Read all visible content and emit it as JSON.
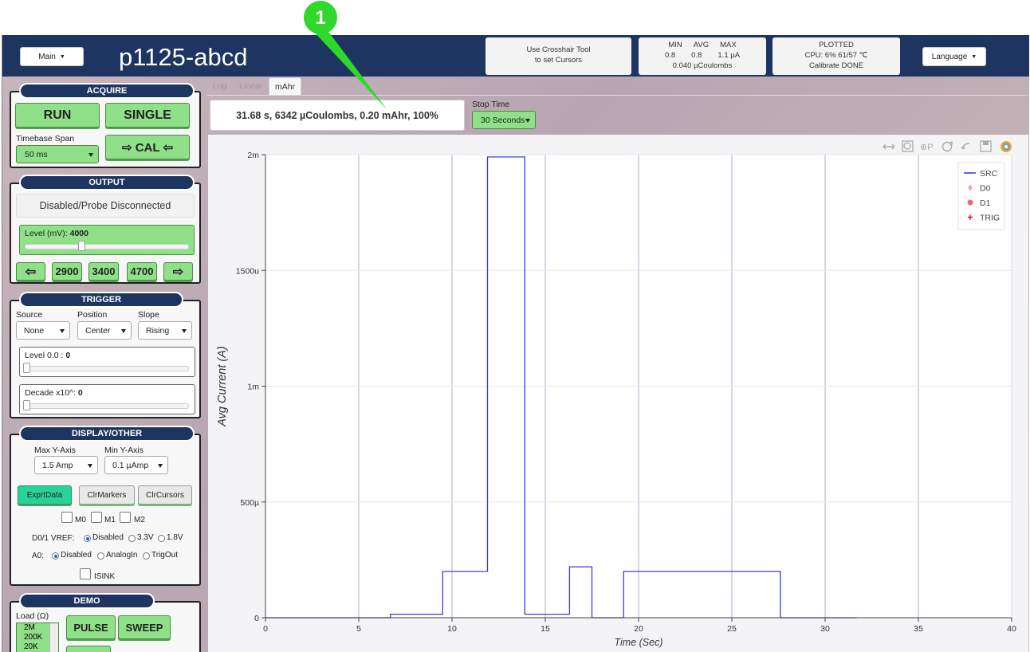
{
  "callout": {
    "number": "1"
  },
  "header": {
    "main_menu": "Main",
    "title": "p1125-abcd",
    "cursor_hint_line1": "Use Crosshair Tool",
    "cursor_hint_line2": "to set Cursors",
    "stats_labels": {
      "min": "MIN",
      "avg": "AVG",
      "max": "MAX"
    },
    "stats_values": {
      "min": "0.8",
      "avg": "0.8",
      "max": "1.1 µA"
    },
    "stats_charge": "0.040 µCoulombs",
    "status_line1": "PLOTTED",
    "status_line2": "CPU:  6% 61/57 ℃",
    "status_line3": "Calibrate DONE",
    "language": "Language"
  },
  "acquire": {
    "title": "ACQUIRE",
    "run": "RUN",
    "single": "SINGLE",
    "timebase_label": "Timebase Span",
    "timebase_value": "50 ms",
    "cal": "⇨ CAL ⇦"
  },
  "output": {
    "title": "OUTPUT",
    "status": "Disabled/Probe Disconnected",
    "level_label": "Level (mV): ",
    "level_value": "4000",
    "level_fraction": 0.35,
    "left_arrow": "⇦",
    "presets": [
      "2900",
      "3400",
      "4700"
    ],
    "right_arrow": "⇨"
  },
  "trigger": {
    "title": "TRIGGER",
    "source_label": "Source",
    "source_value": "None",
    "position_label": "Position",
    "position_value": "Center",
    "slope_label": "Slope",
    "slope_value": "Rising",
    "level_label": "Level 0.0 : ",
    "level_value": "0",
    "decade_label": "Decade x10^: ",
    "decade_value": "0"
  },
  "display": {
    "title": "DISPLAY/OTHER",
    "max_y_label": "Max Y-Axis",
    "max_y_value": "1.5 Amp",
    "min_y_label": "Min Y-Axis",
    "min_y_value": "0.1 µAmp",
    "export": "ExprtData",
    "clr_markers": "ClrMarkers",
    "clr_cursors": "ClrCursors",
    "markers": [
      "M0",
      "M1",
      "M2"
    ],
    "vref_label": "D0/1 VREF:",
    "vref_options": [
      "Disabled",
      "3.3V",
      "1.8V"
    ],
    "a0_label": "A0:",
    "a0_options": [
      "Disabled",
      "AnalogIn",
      "TrigOut"
    ],
    "isink": "ISINK"
  },
  "demo": {
    "title": "DEMO",
    "load_label": "Load (Ω)",
    "loads": [
      "2M",
      "200K",
      "20K"
    ],
    "pulse": "PULSE",
    "sweep": "SWEEP"
  },
  "tabs": [
    "Log",
    "Linear",
    "mAhr"
  ],
  "active_tab": "mAhr",
  "summary": "31.68 s, 6342 µCoulombs, 0.20 mAhr, 100%",
  "stop_time": {
    "label": "Stop Time",
    "value": "30 Seconds"
  },
  "chart_data": {
    "type": "line",
    "xlabel": "Time (Sec)",
    "ylabel": "Avg Current (A)",
    "xlim": [
      0,
      40
    ],
    "ylim": [
      0,
      0.002
    ],
    "x_ticks": [
      0,
      5,
      10,
      15,
      20,
      25,
      30,
      35,
      40
    ],
    "x_tick_labels": [
      "0",
      "5",
      "10",
      "15",
      "20",
      "25",
      "30",
      "35",
      "40"
    ],
    "y_ticks": [
      0,
      0.0005,
      0.001,
      0.0015,
      0.002
    ],
    "y_tick_labels": [
      "0",
      "500µ",
      "1m",
      "1500u",
      "2m"
    ],
    "legend": [
      "SRC",
      "D0",
      "D1",
      "TRIG"
    ],
    "legend_position": "top-right",
    "series": [
      {
        "name": "SRC",
        "color": "#3b3bdc",
        "x": [
          0,
          6.7,
          6.7,
          9.5,
          9.5,
          11.9,
          11.9,
          13.9,
          13.9,
          16.3,
          16.3,
          17.5,
          17.5,
          19.2,
          19.2,
          27.6,
          27.6,
          31.7
        ],
        "y": [
          0,
          0,
          1.5e-05,
          1.5e-05,
          0.0002,
          0.0002,
          0.00199,
          0.00199,
          1.5e-05,
          1.5e-05,
          0.00022,
          0.00022,
          0,
          0,
          0.0002,
          0.0002,
          0,
          0
        ]
      }
    ]
  }
}
